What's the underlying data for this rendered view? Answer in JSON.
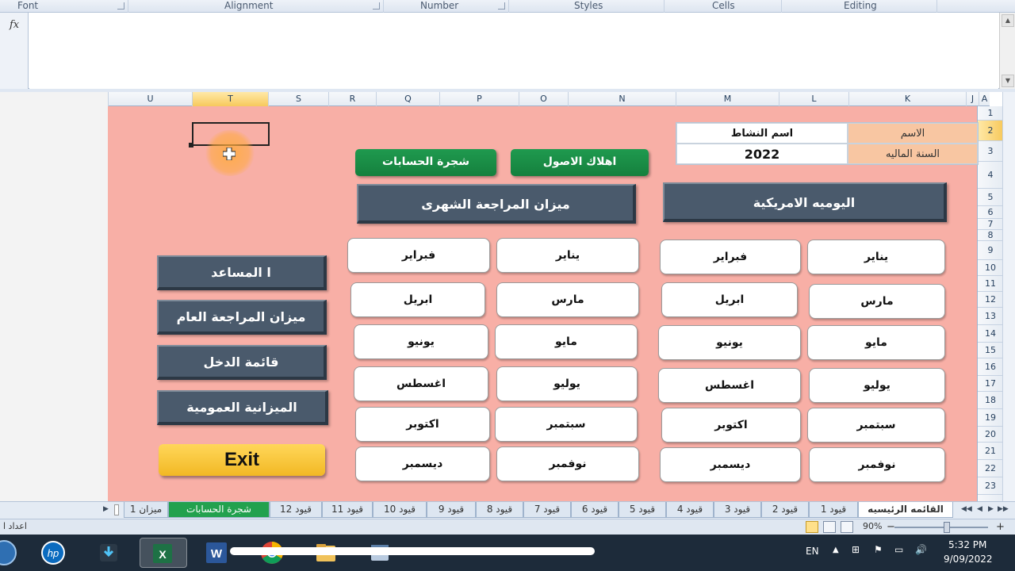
{
  "ribbon": {
    "groups": [
      "Font",
      "Alignment",
      "Number",
      "Styles",
      "Cells",
      "Editing"
    ]
  },
  "formula_bar": {
    "fx_label": "fx",
    "value": ""
  },
  "columns": [
    "U",
    "T",
    "S",
    "R",
    "Q",
    "P",
    "O",
    "N",
    "M",
    "L",
    "K",
    "J",
    "A"
  ],
  "active_column": "T",
  "rows": [
    "1",
    "2",
    "3",
    "4",
    "5",
    "6",
    "7",
    "8",
    "9",
    "10",
    "11",
    "12",
    "13",
    "14",
    "15",
    "16",
    "17",
    "18",
    "19",
    "20",
    "21",
    "22",
    "23"
  ],
  "active_row": "2",
  "info": {
    "name_label": "الاسم",
    "name_value": "اسم النشاط",
    "year_label": "السنة الماليه",
    "year_value": "2022"
  },
  "buttons": {
    "depreciation": "اهلاك الاصول",
    "chart_of_accounts": "شجرة الحسابات",
    "trial_balance_monthly": "ميزان المراجعة الشهرى",
    "american_journal": "اليوميه الامريكية",
    "assistant": "ا المساعد",
    "trial_balance_general": "ميزان المراجعة العام",
    "income_statement": "قائمة الدخل",
    "balance_sheet": "الميزانية العمومية",
    "exit": "Exit"
  },
  "months_journal": [
    "يناير",
    "فبراير",
    "مارس",
    "ابريل",
    "مايو",
    "يونيو",
    "يوليو",
    "اغسطس",
    "سبتمبر",
    "اكتوبر",
    "نوفمبر",
    "ديسمبر"
  ],
  "months_trial": [
    "يناير",
    "فبراير",
    "مارس",
    "ابريل",
    "مايو",
    "يونيو",
    "يوليو",
    "اغسطس",
    "سبتمبر",
    "اكتوبر",
    "نوفمبر",
    "ديسمبر"
  ],
  "sheet_tabs": [
    "القائمه الرئيسيه",
    "قيود 1",
    "قيود 2",
    "قيود 3",
    "قيود 4",
    "قيود 5",
    "قيود 6",
    "قيود 7",
    "قيود 8",
    "قيود 9",
    "قيود 10",
    "قيود 11",
    "قيود 12",
    "شجرة الحسابات",
    "ميزان 1"
  ],
  "status": {
    "left_text": "اعداد ا",
    "zoom": "90%",
    "zoom_fraction": 0.9
  },
  "taskbar": {
    "lang": "EN",
    "time": "5:32 PM",
    "date": "9/09/2022"
  },
  "colors": {
    "sheet_bg": "#f8afa6",
    "green_button": "#15803d",
    "slate_button": "#4a5a6c",
    "exit_button": "#f2b824"
  }
}
